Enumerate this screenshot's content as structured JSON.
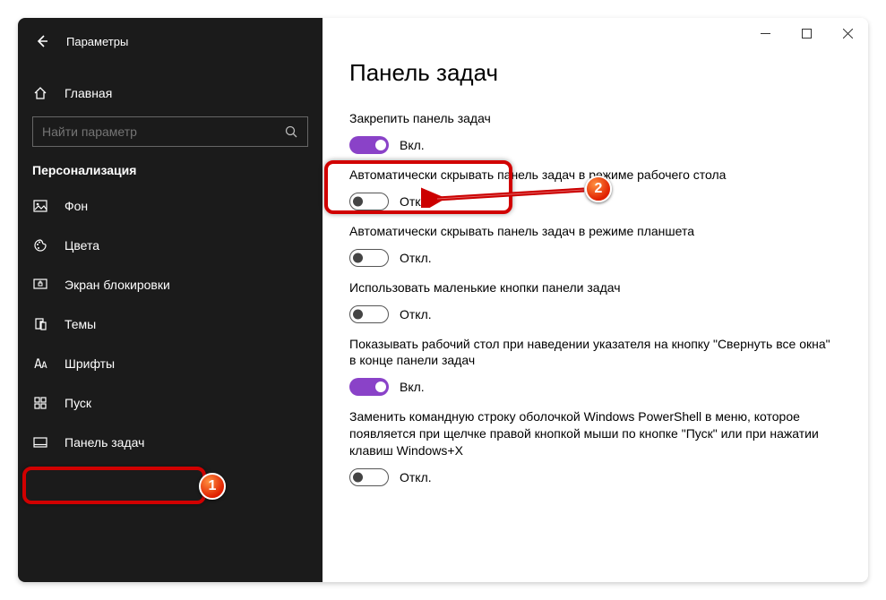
{
  "window": {
    "app_title": "Параметры"
  },
  "sidebar": {
    "home": "Главная",
    "search_placeholder": "Найти параметр",
    "section": "Персонализация",
    "items": [
      {
        "icon": "image-icon",
        "label": "Фон"
      },
      {
        "icon": "palette-icon",
        "label": "Цвета"
      },
      {
        "icon": "lock-icon",
        "label": "Экран блокировки"
      },
      {
        "icon": "theme-icon",
        "label": "Темы"
      },
      {
        "icon": "font-icon",
        "label": "Шрифты"
      },
      {
        "icon": "start-icon",
        "label": "Пуск"
      },
      {
        "icon": "taskbar-icon",
        "label": "Панель задач"
      }
    ],
    "selected_index": 6
  },
  "page": {
    "title": "Панель задач",
    "on_label": "Вкл.",
    "off_label": "Откл.",
    "settings": [
      {
        "label": "Закрепить панель задач",
        "value": true
      },
      {
        "label": "Автоматически скрывать панель задач в режиме рабочего стола",
        "value": false
      },
      {
        "label": "Автоматически скрывать панель задач в режиме планшета",
        "value": false
      },
      {
        "label": "Использовать маленькие кнопки панели задач",
        "value": false
      },
      {
        "label": "Показывать рабочий стол при наведении указателя на кнопку \"Свернуть все окна\" в конце панели задач",
        "value": true
      },
      {
        "label": "Заменить командную строку оболочкой Windows PowerShell в меню, которое появляется при щелчке правой кнопкой мыши по кнопке \"Пуск\" или при нажатии клавиш Windows+X",
        "value": false
      }
    ]
  },
  "annotations": {
    "badge1": "1",
    "badge2": "2"
  }
}
